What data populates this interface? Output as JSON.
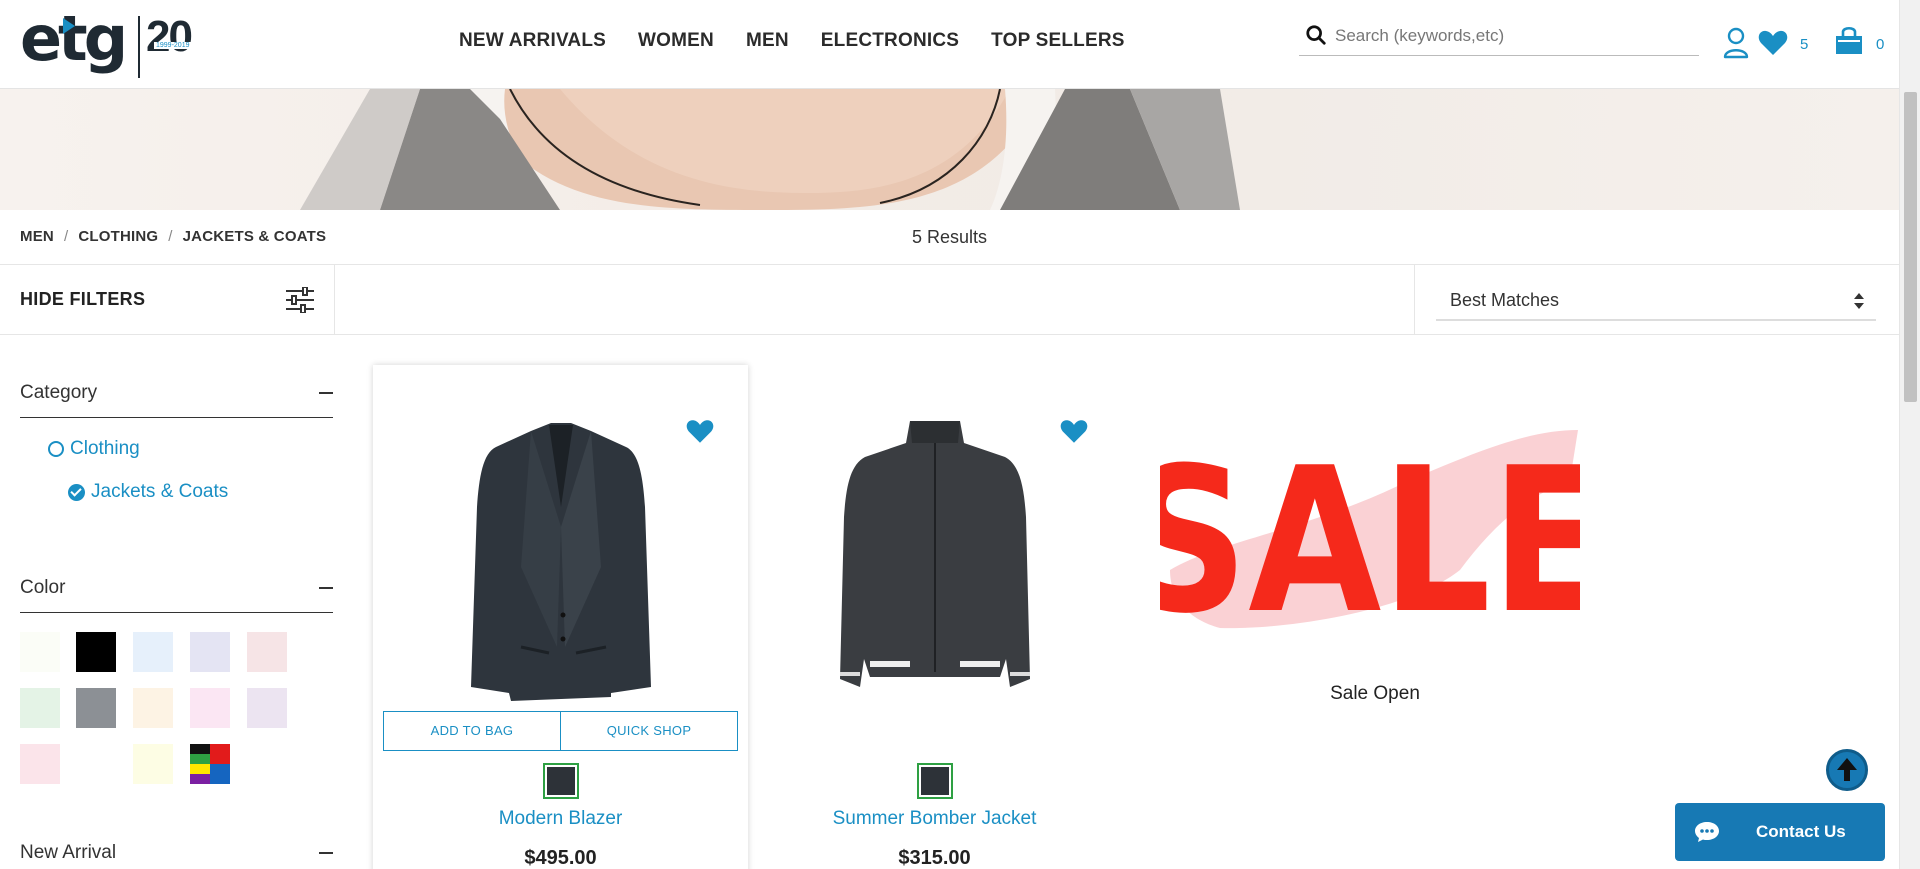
{
  "header": {
    "logo_text": "etg",
    "logo_anniv": "20",
    "logo_years": "1999-2019",
    "nav": [
      "NEW ARRIVALS",
      "WOMEN",
      "MEN",
      "ELECTRONICS",
      "TOP SELLERS"
    ],
    "search_placeholder": "Search (keywords,etc)",
    "wishlist_count": "5",
    "bag_count": "0"
  },
  "breadcrumb": [
    "MEN",
    "CLOTHING",
    "JACKETS & COATS"
  ],
  "results": "5 Results",
  "toolbar": {
    "hide_filters": "HIDE FILTERS",
    "sort_value": "Best Matches"
  },
  "sidebar": {
    "category_title": "Category",
    "categories": [
      "Clothing",
      "Jackets & Coats"
    ],
    "color_title": "Color",
    "colors": [
      "#fbfdf7",
      "#000000",
      "#e6f0fb",
      "#e4e4f3",
      "#f6e4e6",
      "#e4f3e6",
      "#8c9095",
      "#fdf3e4",
      "#fbe6f3",
      "#ece4f1",
      "#fbe4ea",
      "#ffffff",
      "#fdfde4",
      "multicolor"
    ],
    "new_arrival_title": "New Arrival"
  },
  "products": [
    {
      "name": "Modern Blazer",
      "price": "$495.00",
      "add_to_bag": "ADD TO BAG",
      "quick_shop": "QUICK SHOP"
    },
    {
      "name": "Summer Bomber Jacket",
      "price": "$315.00"
    }
  ],
  "promo": {
    "sale_text": "SALE",
    "caption": "Sale Open"
  },
  "contact": {
    "label": "Contact Us"
  },
  "colors": {
    "accent": "#1a8fc4",
    "button": "#1779b4",
    "sale_red": "#f5291b"
  }
}
